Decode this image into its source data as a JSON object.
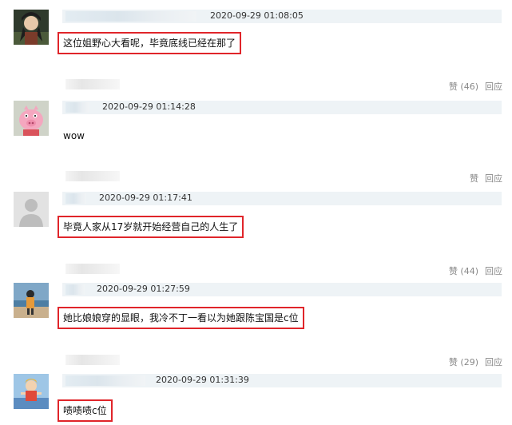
{
  "comments": [
    {
      "date": "2020-09-29 01:08:05",
      "text": "这位姐野心大看呢，毕竟底线已经在那了",
      "avatar": "anime-character-avatar"
    },
    {
      "date": "2020-09-29 01:14:28",
      "text": "wow",
      "avatar": "pink-pig-avatar",
      "likes_label": "赞 (46)",
      "reply_label": "回应"
    },
    {
      "date": "2020-09-29 01:17:41",
      "text": "毕竟人家从17岁就开始经营自己的人生了",
      "avatar": "default-user-avatar",
      "likes_label": "赞",
      "reply_label": "回应"
    },
    {
      "date": "2020-09-29 01:27:59",
      "text": "她比娘娘穿的显眼，我冷不丁一看以为她跟陈宝国是c位",
      "avatar": "beach-photo-avatar",
      "likes_label": "赞 (44)",
      "reply_label": "回应"
    },
    {
      "date": "2020-09-29 01:31:39",
      "text": "啧啧啧c位",
      "avatar": "cartoon-figure-avatar",
      "likes_label": "赞 (29)",
      "reply_label": "回应"
    }
  ],
  "colors": {
    "highlight_border": "#e0252a",
    "name_bar": "#eef3f6",
    "action_text": "#888888"
  }
}
